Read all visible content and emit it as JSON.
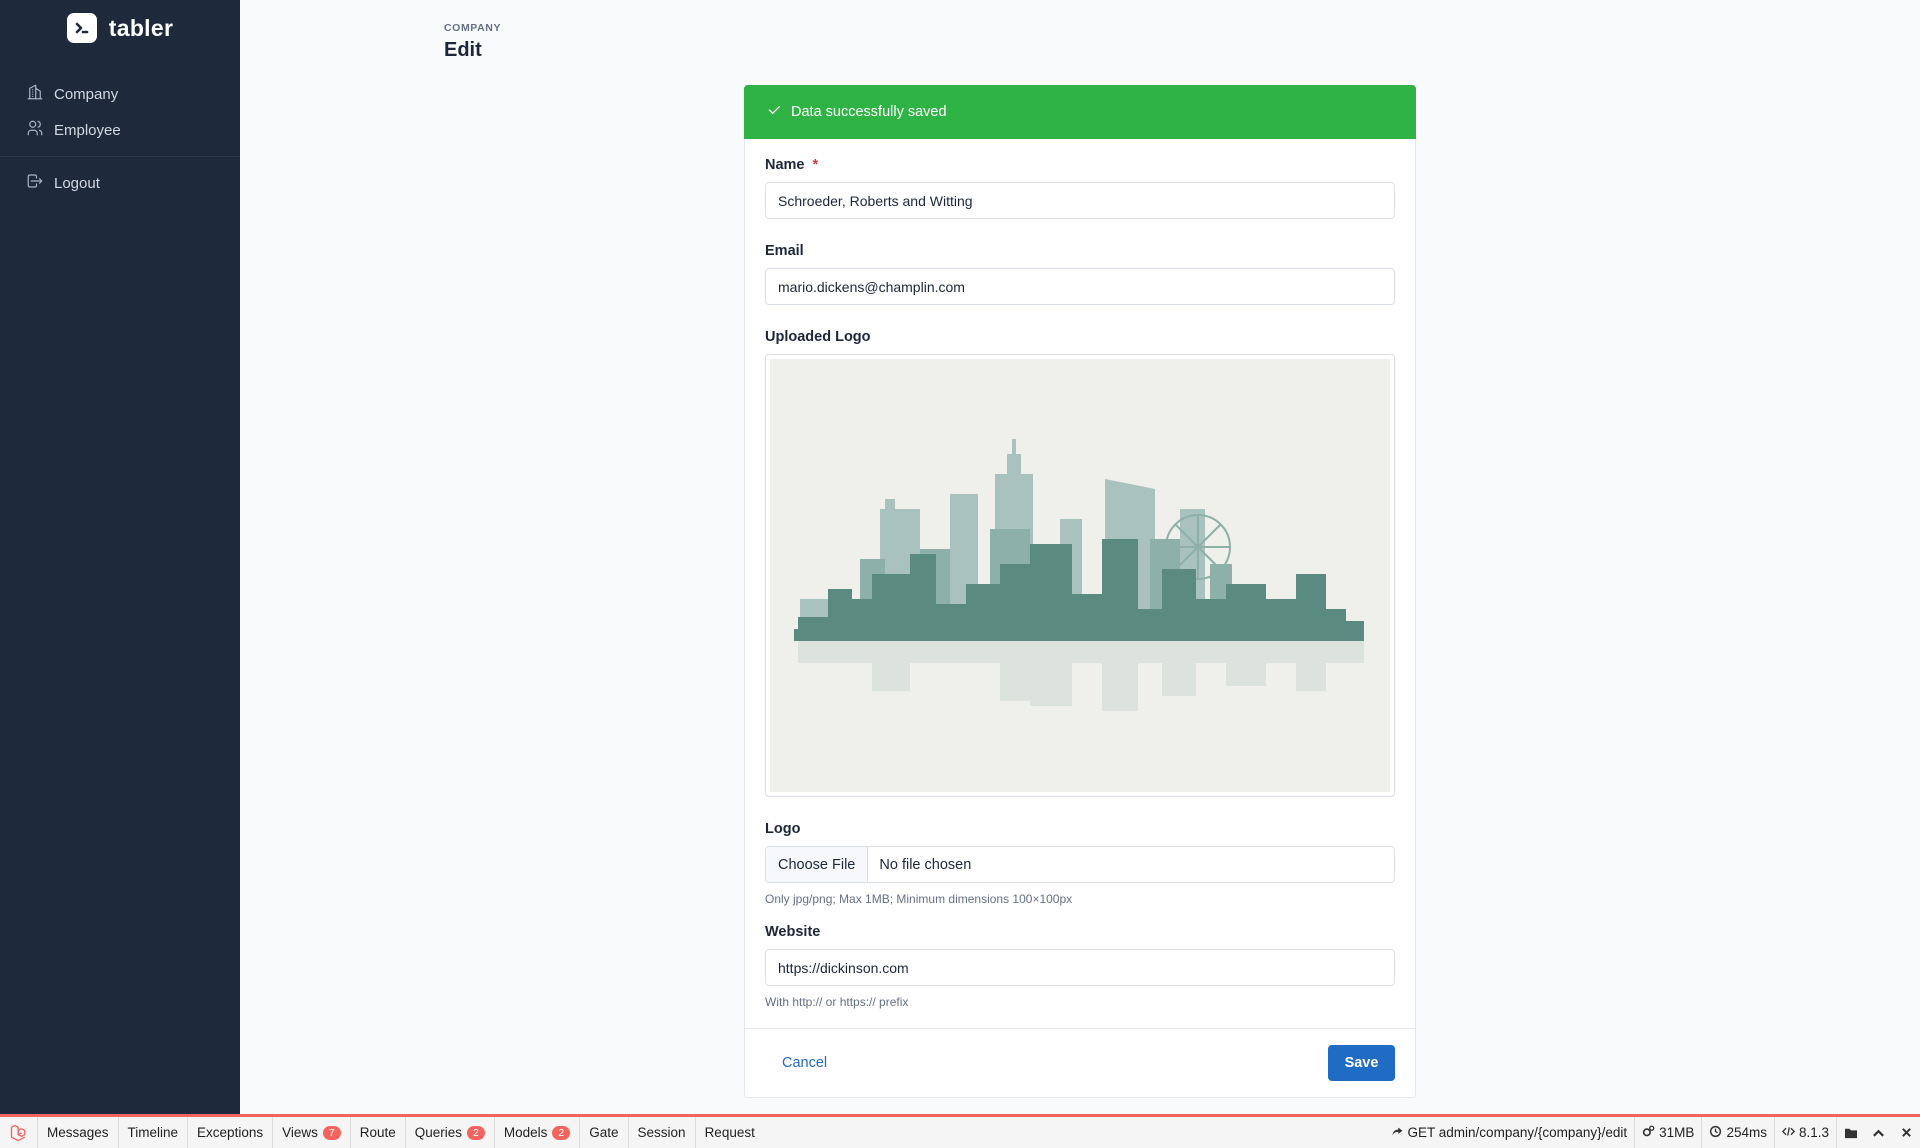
{
  "brand": {
    "name": "tabler"
  },
  "sidebar": {
    "items": [
      {
        "label": "Company",
        "icon": "building-icon"
      },
      {
        "label": "Employee",
        "icon": "users-icon"
      }
    ],
    "logout_label": "Logout"
  },
  "header": {
    "pretitle": "COMPANY",
    "title": "Edit"
  },
  "alert": {
    "text": "Data successfully saved",
    "color": "#2fb344"
  },
  "form": {
    "name_label": "Name",
    "name_required": "*",
    "name_value": "Schroeder, Roberts and Witting",
    "email_label": "Email",
    "email_value": "mario.dickens@champlin.com",
    "uploaded_logo_label": "Uploaded Logo",
    "logo_label": "Logo",
    "file_button": "Choose File",
    "file_status": "No file chosen",
    "logo_hint": "Only jpg/png; Max 1MB; Minimum dimensions 100×100px",
    "website_label": "Website",
    "website_value": "https://dickinson.com",
    "website_hint": "With http:// or https:// prefix",
    "cancel_label": "Cancel",
    "save_label": "Save"
  },
  "debugbar": {
    "tabs": [
      {
        "label": "Messages",
        "badge": ""
      },
      {
        "label": "Timeline",
        "badge": ""
      },
      {
        "label": "Exceptions",
        "badge": ""
      },
      {
        "label": "Views",
        "badge": "7"
      },
      {
        "label": "Route",
        "badge": ""
      },
      {
        "label": "Queries",
        "badge": "2"
      },
      {
        "label": "Models",
        "badge": "2"
      },
      {
        "label": "Gate",
        "badge": ""
      },
      {
        "label": "Session",
        "badge": ""
      },
      {
        "label": "Request",
        "badge": ""
      }
    ],
    "route": "GET admin/company/{company}/edit",
    "memory": "31MB",
    "time": "254ms",
    "php_version": "8.1.3"
  },
  "colors": {
    "primary": "#206bc4",
    "sidebar": "#1e293b",
    "debug_accent": "#f4645f"
  }
}
